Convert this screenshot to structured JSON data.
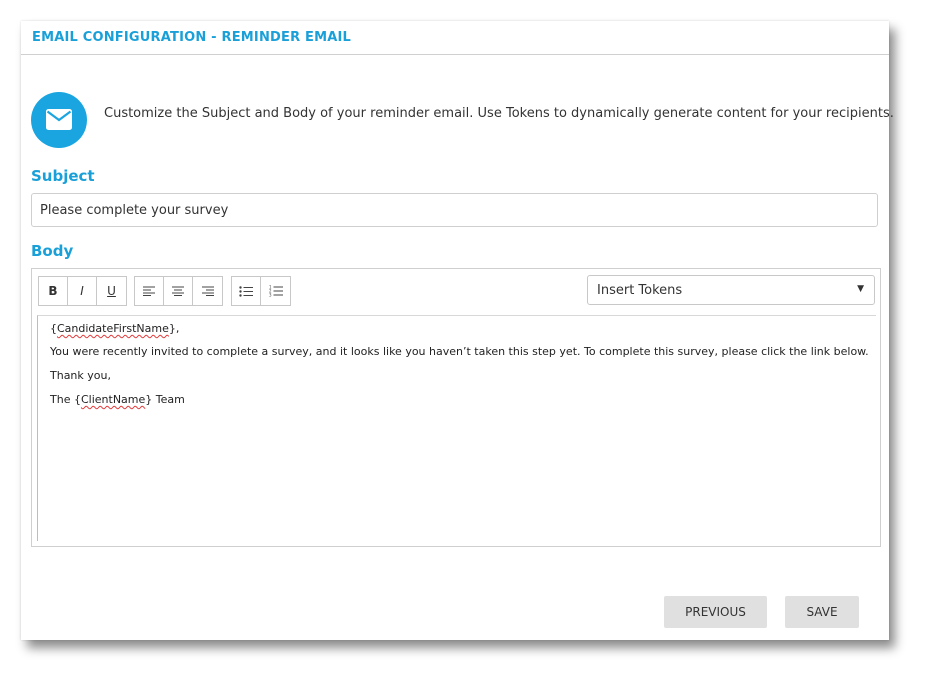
{
  "header": {
    "title": "EMAIL CONFIGURATION - REMINDER EMAIL"
  },
  "info": {
    "icon": "envelope-icon",
    "text": "Customize the Subject and Body of your reminder email. Use Tokens to dynamically generate content for your recipients."
  },
  "subject": {
    "label": "Subject",
    "value": "Please complete your survey"
  },
  "body": {
    "label": "Body",
    "toolbar": {
      "bold": "B",
      "italic": "I",
      "underline": "U",
      "align_left_icon": "align-left-icon",
      "align_center_icon": "align-center-icon",
      "align_right_icon": "align-right-icon",
      "bullet_list_icon": "bullet-list-icon",
      "numbered_list_icon": "numbered-list-icon"
    },
    "insert_tokens": {
      "selected": "Insert Tokens"
    },
    "content": {
      "line1_open": "{",
      "line1_token": "CandidateFirstName",
      "line1_close": "},",
      "line2": "You were recently invited to complete a survey, and it looks like you haven’t taken this step yet. To complete this survey, please click the link below.",
      "line3": "Thank you,",
      "line4_pre": "The {",
      "line4_token": "ClientName",
      "line4_post": "} Team"
    }
  },
  "footer": {
    "previous_label": "PREVIOUS",
    "save_label": "SAVE"
  },
  "colors": {
    "accent": "#1aa0d8",
    "icon_bg": "#1aa5e0",
    "button_bg": "#e0e0e0"
  }
}
